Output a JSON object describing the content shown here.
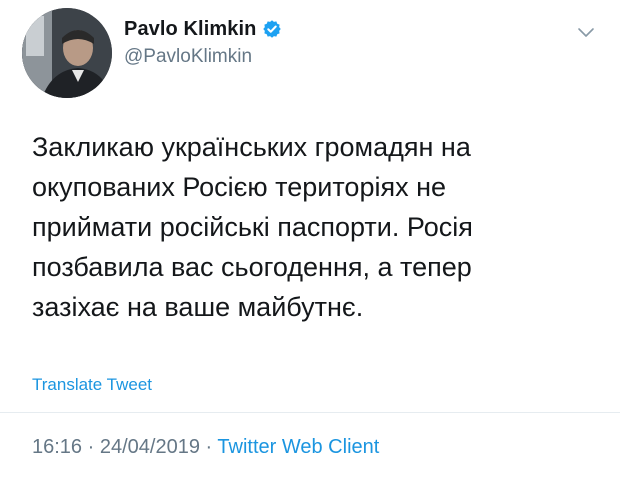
{
  "author": {
    "display_name": "Pavlo Klimkin",
    "handle": "@PavloKlimkin",
    "verified": true
  },
  "tweet": {
    "text_lines": [
      "Закликаю українських громадян на",
      "окупованих Росією територіях не",
      "приймати російські паспорти. Росія",
      "позбавила вас сьогодення, а тепер",
      "зазіхає на ваше майбутнє."
    ]
  },
  "translate_label": "Translate Tweet",
  "meta": {
    "time": "16:16",
    "separator": "·",
    "date": "24/04/2019",
    "source": "Twitter Web Client"
  },
  "icons": {
    "verified": "verified-badge-icon",
    "caret": "chevron-down-icon"
  },
  "colors": {
    "link": "#1b95e0",
    "secondary_text": "#657786",
    "primary_text": "#14171a",
    "verified_badge": "#1da1f2"
  }
}
